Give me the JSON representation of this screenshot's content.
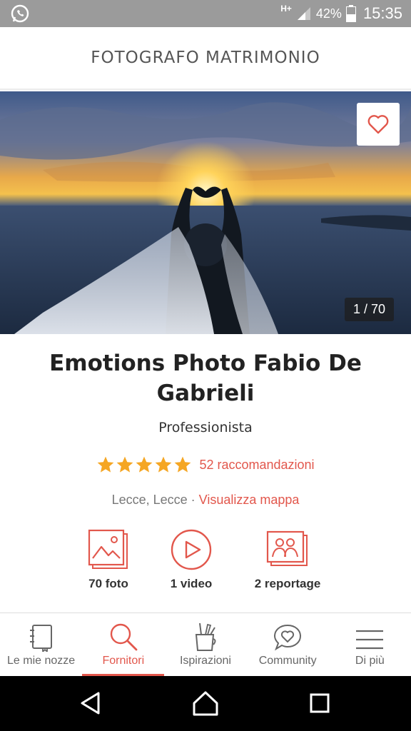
{
  "status_bar": {
    "network": "H+",
    "battery": "42%",
    "time": "15:35"
  },
  "header": {
    "title": "FOTOGRAFO MATRIMONIO"
  },
  "hero": {
    "counter": "1 / 70"
  },
  "vendor": {
    "name": "Emotions Photo Fabio De Gabrieli",
    "type": "Professionista",
    "rating_stars": 5,
    "recommendations": "52 raccomandazioni",
    "location": "Lecce, Lecce",
    "separator": " · ",
    "map_link": "Visualizza mappa"
  },
  "media": {
    "photos": "70 foto",
    "videos": "1 video",
    "reportage": "2 reportage"
  },
  "bottom_nav": {
    "items": [
      {
        "label": "Le mie nozze",
        "icon": "notebook-icon"
      },
      {
        "label": "Fornitori",
        "icon": "search-icon"
      },
      {
        "label": "Ispirazioni",
        "icon": "brush-cup-icon"
      },
      {
        "label": "Community",
        "icon": "heart-bubble-icon"
      },
      {
        "label": "Di più",
        "icon": "menu-icon"
      }
    ],
    "active_index": 1
  },
  "colors": {
    "accent": "#e2574c",
    "star": "#f5a623",
    "status_bar": "#9b9b9b"
  }
}
